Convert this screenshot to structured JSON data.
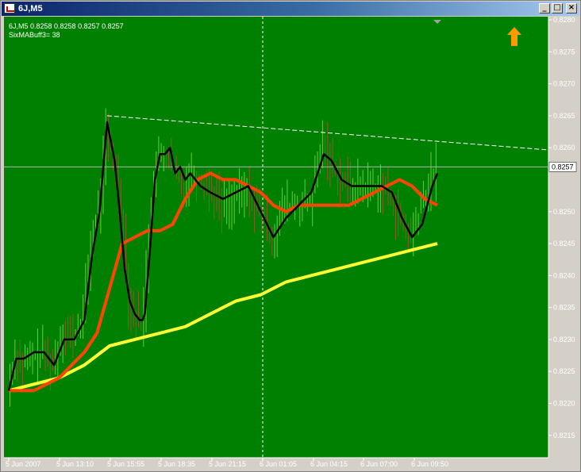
{
  "window": {
    "title": "6J,M5",
    "buttons": {
      "minimize": "_",
      "restore": "□",
      "close": "×"
    }
  },
  "chart_info": {
    "header": "6J,M5  0.8258 0.8258 0.8257 0.8257",
    "indicator": "SixMABuff3= 38"
  },
  "chart_data": {
    "type": "candlestick",
    "symbol": "6J",
    "timeframe": "M5",
    "ohlc_current": [
      0.8258,
      0.8258,
      0.8257,
      0.8257
    ],
    "current_price": 0.8257,
    "y_ticks": [
      "0.8280",
      "0.8275",
      "0.8270",
      "0.8265",
      "0.8260",
      "0.8250",
      "0.8245",
      "0.8240",
      "0.8235",
      "0.8230",
      "0.8225",
      "0.8220",
      "0.8215"
    ],
    "ylim": [
      0.82115,
      0.82805
    ],
    "x_ticks": [
      "5 Jun 2007",
      "5 Jun 13:10",
      "5 Jun 15:55",
      "5 Jun 18:35",
      "5 Jun 21:15",
      "6 Jun 01:05",
      "6 Jun 04:15",
      "6 Jun 07:00",
      "6 Jun 09:50"
    ],
    "bar_count": 170,
    "vertical_marker_tick": "5 Jun 21:15",
    "series": [
      {
        "name": "price",
        "x": [
          0,
          3,
          6,
          10,
          14,
          18,
          22,
          26,
          30,
          33,
          36,
          39,
          42,
          44,
          46,
          48,
          50,
          52,
          53,
          54,
          56,
          58,
          60,
          62,
          64,
          66,
          68,
          70,
          72,
          74,
          76,
          80,
          85,
          90,
          95,
          100,
          105,
          110,
          115,
          120,
          125,
          128,
          132,
          136,
          140,
          144,
          148,
          152,
          156,
          160,
          164,
          168,
          170
        ],
        "values": [
          0.8222,
          0.8228,
          0.8226,
          0.8227,
          0.8228,
          0.8226,
          0.8232,
          0.823,
          0.8234,
          0.8245,
          0.825,
          0.8262,
          0.8258,
          0.8254,
          0.8247,
          0.8236,
          0.8234,
          0.8233,
          0.8232,
          0.8235,
          0.8247,
          0.8256,
          0.8258,
          0.8259,
          0.8258,
          0.8256,
          0.8255,
          0.8254,
          0.8256,
          0.8256,
          0.8255,
          0.8254,
          0.8251,
          0.8252,
          0.8253,
          0.825,
          0.8246,
          0.8251,
          0.8251,
          0.8251,
          0.8261,
          0.8258,
          0.8255,
          0.8254,
          0.8254,
          0.8254,
          0.8254,
          0.8252,
          0.8248,
          0.8246,
          0.8251,
          0.8255,
          0.8257
        ]
      },
      {
        "name": "ma_black",
        "x": [
          0,
          3,
          6,
          10,
          14,
          18,
          22,
          26,
          30,
          33,
          36,
          39,
          42,
          44,
          46,
          48,
          50,
          52,
          53,
          54,
          56,
          58,
          60,
          62,
          64,
          66,
          68,
          70,
          72,
          74,
          76,
          80,
          85,
          90,
          95,
          100,
          105,
          110,
          115,
          120,
          125,
          128,
          132,
          136,
          140,
          144,
          148,
          152,
          156,
          160,
          164,
          168,
          170
        ],
        "values": [
          0.8222,
          0.8227,
          0.8227,
          0.8228,
          0.8228,
          0.8226,
          0.823,
          0.823,
          0.8233,
          0.8243,
          0.825,
          0.8264,
          0.8258,
          0.825,
          0.8241,
          0.8236,
          0.8234,
          0.8233,
          0.8233,
          0.8234,
          0.8244,
          0.8255,
          0.8259,
          0.8259,
          0.826,
          0.8256,
          0.8257,
          0.8255,
          0.8256,
          0.8255,
          0.8254,
          0.8253,
          0.8252,
          0.8253,
          0.8254,
          0.825,
          0.8246,
          0.8249,
          0.8251,
          0.8253,
          0.8259,
          0.8258,
          0.8255,
          0.8254,
          0.8254,
          0.8254,
          0.8254,
          0.8253,
          0.8249,
          0.8246,
          0.8248,
          0.8254,
          0.8256
        ]
      },
      {
        "name": "ma_orange",
        "x": [
          0,
          5,
          10,
          15,
          20,
          25,
          30,
          35,
          40,
          45,
          50,
          55,
          60,
          65,
          70,
          75,
          80,
          85,
          90,
          95,
          100,
          105,
          110,
          115,
          120,
          125,
          130,
          135,
          140,
          145,
          150,
          155,
          160,
          165,
          170
        ],
        "values": [
          0.8222,
          0.8222,
          0.8222,
          0.8223,
          0.8224,
          0.8226,
          0.8228,
          0.8231,
          0.8238,
          0.8245,
          0.8246,
          0.8247,
          0.8247,
          0.8248,
          0.8252,
          0.8255,
          0.8256,
          0.8255,
          0.8255,
          0.8254,
          0.8253,
          0.8251,
          0.825,
          0.8251,
          0.8251,
          0.8251,
          0.8251,
          0.8251,
          0.8252,
          0.8253,
          0.8254,
          0.8255,
          0.8254,
          0.8252,
          0.8251
        ]
      },
      {
        "name": "ma_yellow",
        "x": [
          0,
          10,
          20,
          30,
          40,
          50,
          60,
          70,
          80,
          90,
          100,
          110,
          120,
          130,
          140,
          150,
          160,
          170
        ],
        "values": [
          0.8222,
          0.8223,
          0.8224,
          0.8226,
          0.8229,
          0.823,
          0.8231,
          0.8232,
          0.8234,
          0.8236,
          0.8237,
          0.8239,
          0.824,
          0.8241,
          0.8242,
          0.8243,
          0.8244,
          0.8245
        ]
      }
    ],
    "trendline": {
      "x": [
        39,
        170
      ],
      "values": [
        0.8265,
        0.8261
      ]
    },
    "colors": {
      "background": "#008000",
      "axis": "#ffffff",
      "bull": "#66cc33",
      "bear": "#8b5a2b",
      "ma_black": "#000000",
      "ma_orange": "#ff4500",
      "ma_yellow": "#ffff33",
      "arrow": "#ff9900",
      "marker": "#a0a0a0"
    },
    "arrow_icon": "up-arrow-icon"
  }
}
